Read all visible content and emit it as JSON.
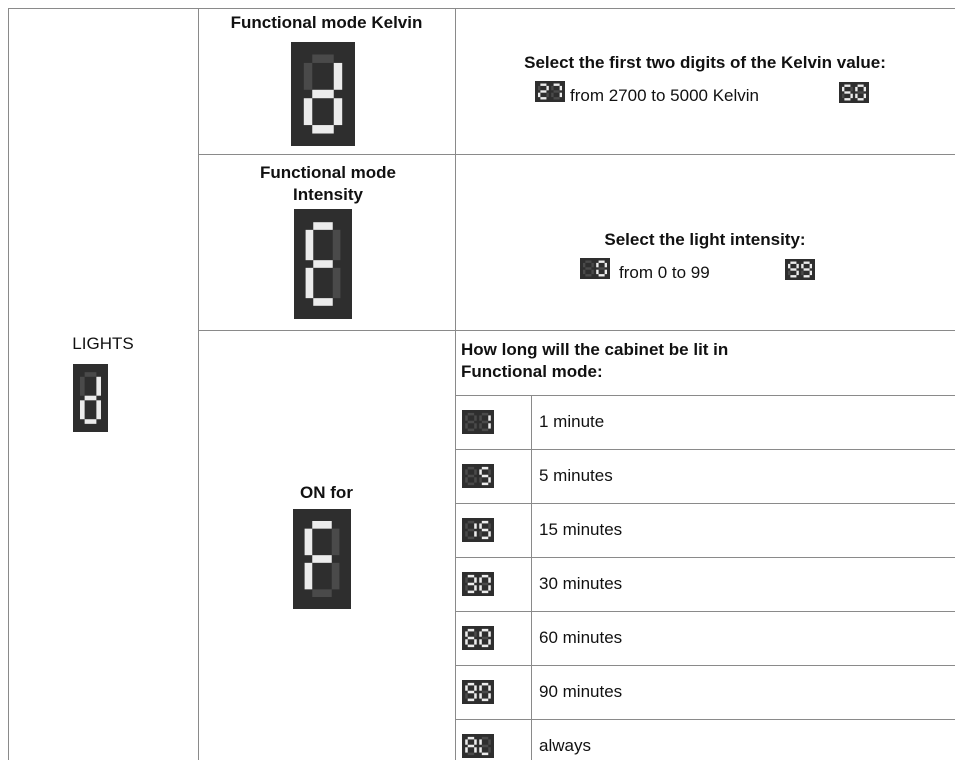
{
  "row_header": {
    "label": "LIGHTS",
    "display": "d"
  },
  "kelvin": {
    "title": "Functional mode Kelvin",
    "display": "d",
    "heading": "Select the first two digits of the Kelvin value:",
    "range_text": "from 2700 to 5000 Kelvin",
    "from_display": "27",
    "to_display": "50"
  },
  "intensity": {
    "title": "Functional mode Intensity",
    "display": "E",
    "heading": "Select the light intensity:",
    "range_text": "from 0 to 99",
    "from_display": "0",
    "to_display": "99"
  },
  "on_for": {
    "title": "ON for",
    "display": "F",
    "heading": "How long will the cabinet be lit in Functional mode:",
    "options": [
      {
        "display": "1",
        "label": "1 minute"
      },
      {
        "display": "5",
        "label": "5 minutes"
      },
      {
        "display": "15",
        "label": "15 minutes"
      },
      {
        "display": "30",
        "label": "30 minutes"
      },
      {
        "display": "60",
        "label": "60 minutes"
      },
      {
        "display": "90",
        "label": "90 minutes"
      },
      {
        "display": "AL",
        "label": "always"
      }
    ]
  }
}
